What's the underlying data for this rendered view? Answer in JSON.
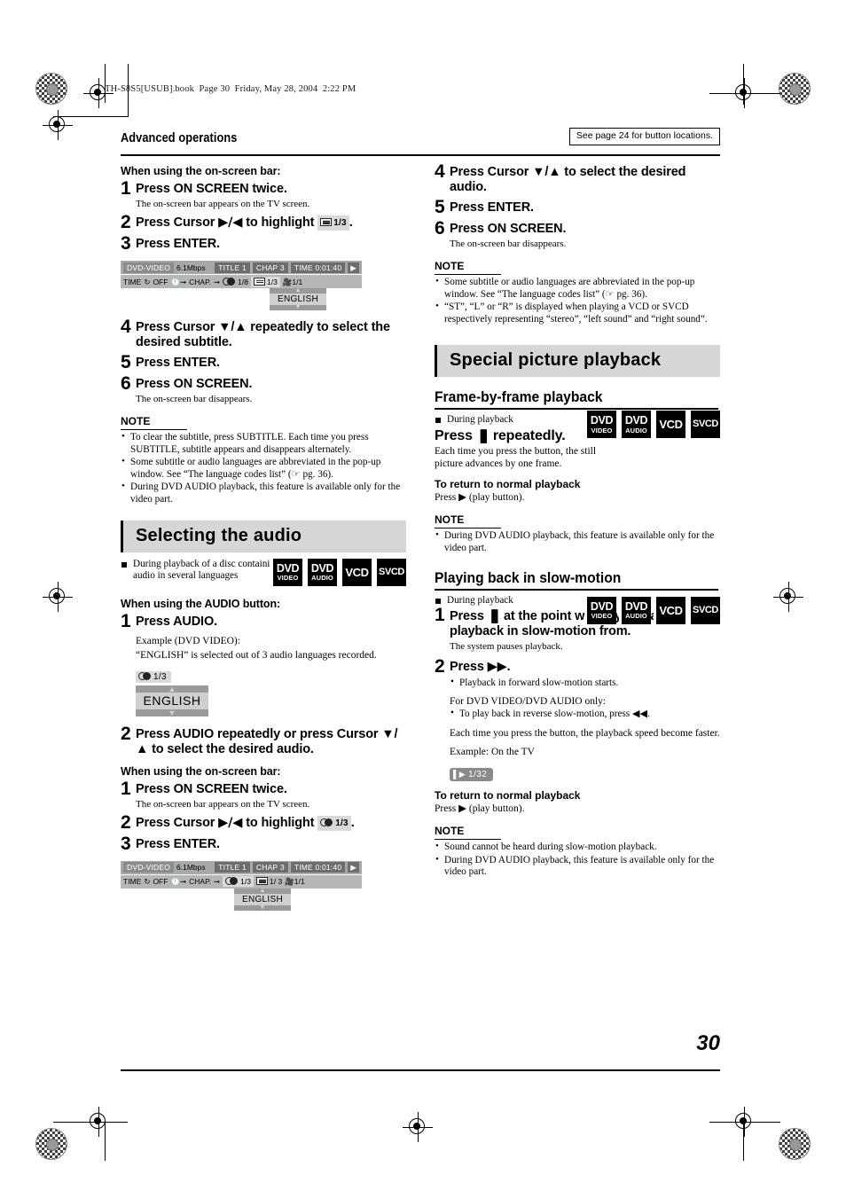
{
  "file_header": "TH-S8S5[USUB].book  Page 30  Friday, May 28, 2004  2:22 PM",
  "running_head": "Advanced operations",
  "see_page_note": "See page 24 for button locations.",
  "page_number": "30",
  "left_column": {
    "subhead_onscreen": "When using the on-screen bar:",
    "steps_subtitle": [
      {
        "num": "1",
        "title": "Press ON SCREEN twice.",
        "desc": "The on-screen bar appears on the TV screen."
      },
      {
        "num": "2",
        "title_pre": "Press Cursor ",
        "title_mid": "▶/◀",
        "title_post": " to highlight",
        "chip": "1/3",
        "title_end": "."
      },
      {
        "num": "3",
        "title": "Press ENTER.",
        "desc": ""
      },
      {
        "num": "4",
        "title": "Press Cursor ▼/▲ repeatedly to select the desired subtitle.",
        "desc": ""
      },
      {
        "num": "5",
        "title": "Press ENTER.",
        "desc": ""
      },
      {
        "num": "6",
        "title": "Press ON SCREEN.",
        "desc": "The on-screen bar disappears."
      }
    ],
    "osb_top": {
      "disc": "DVD-VIDEO",
      "bitrate": "6.1Mbps",
      "title_label": "TITLE",
      "title_value": "1",
      "chap_label": "CHAP",
      "chap_value": "3",
      "time_label": "TIME",
      "time_value": "0:01:40"
    },
    "osb_bottom_1": {
      "time": "TIME",
      "repeat": "OFF",
      "chap_label": "CHAP.",
      "audio_value": "1/8",
      "subtitle_value": "1/3",
      "angle_value": "1/1",
      "popup_lang": "ENGLISH",
      "highlight": "subtitle"
    },
    "osb_bottom_2": {
      "time": "TIME",
      "repeat": "OFF",
      "chap_label": "CHAP.",
      "audio_value": "1/3",
      "subtitle_value": "1/ 3",
      "angle_value": "1/1",
      "popup_lang": "ENGLISH",
      "highlight": "audio"
    },
    "note_subtitle": {
      "label": "NOTE",
      "items": [
        "To clear the subtitle, press SUBTITLE. Each time you press SUBTITLE, subtitle appears and disappears alternately.",
        "Some subtitle or audio languages are abbreviated in the pop-up window. See “The language codes list” (☞ pg. 36).",
        "During DVD AUDIO playback, this feature is available only for the video part."
      ]
    },
    "banner_audio": "Selecting the audio",
    "audio_condition": "During playback of a disc containing audio in several languages",
    "audio_badges": [
      {
        "line1": "DVD",
        "line2": "VIDEO"
      },
      {
        "line1": "DVD",
        "line2": "AUDIO"
      },
      {
        "line1": "VCD",
        "line2": ""
      },
      {
        "line1": "SVCD",
        "line2": ""
      }
    ],
    "subhead_audio_button": "When using the AUDIO button:",
    "audio_step1": {
      "num": "1",
      "title": "Press AUDIO."
    },
    "audio_example_line1": "Example (DVD VIDEO):",
    "audio_example_line2": "“ENGLISH” is selected out of 3 audio languages recorded.",
    "audio_popup": {
      "tag": "1/3",
      "lang": "ENGLISH"
    },
    "audio_step2": {
      "num": "2",
      "title": "Press AUDIO repeatedly or press Cursor ▼/▲ to select the desired audio."
    },
    "subhead_onscreen2": "When using the on-screen bar:",
    "steps_audio_osb": [
      {
        "num": "1",
        "title": "Press ON SCREEN twice.",
        "desc": "The on-screen bar appears on the TV screen."
      },
      {
        "num": "2",
        "title_pre": "Press Cursor ",
        "title_mid": "▶/◀",
        "title_post": " to highlight",
        "chip": "1/3",
        "title_end": "."
      },
      {
        "num": "3",
        "title": "Press ENTER.",
        "desc": ""
      }
    ]
  },
  "right_column": {
    "steps_top": [
      {
        "num": "4",
        "title": "Press Cursor ▼/▲ to select the desired audio.",
        "desc": ""
      },
      {
        "num": "5",
        "title": "Press ENTER.",
        "desc": ""
      },
      {
        "num": "6",
        "title": "Press ON SCREEN.",
        "desc": "The on-screen bar disappears."
      }
    ],
    "note_audio": {
      "label": "NOTE",
      "items": [
        "Some subtitle or audio languages are abbreviated in the pop-up window. See “The language codes list” (☞ pg. 36).",
        "“ST”, “L” or “R” is displayed when playing a VCD or SVCD respectively representing “stereo”, “left sound” and “right sound”."
      ]
    },
    "banner_special": "Special picture playback",
    "frame_section": {
      "heading": "Frame-by-frame playback",
      "condition": "During playback",
      "instruction_pre": "Press ",
      "instruction_icon": "▐▌",
      "instruction_post": " repeatedly.",
      "desc": "Each time you press the button, the still picture advances by one frame.",
      "return_head": "To return to normal playback",
      "return_text_pre": "Press ",
      "return_text_icon": "▶",
      "return_text_post": " (play button).",
      "badges": [
        {
          "line1": "DVD",
          "line2": "VIDEO"
        },
        {
          "line1": "DVD",
          "line2": "AUDIO"
        },
        {
          "line1": "VCD",
          "line2": ""
        },
        {
          "line1": "SVCD",
          "line2": ""
        }
      ],
      "note": {
        "label": "NOTE",
        "items": [
          "During DVD AUDIO playback, this feature is available only for the video part."
        ]
      }
    },
    "slow_section": {
      "heading": "Playing back in slow-motion",
      "condition": "During playback",
      "step1": {
        "num": "1",
        "title_pre": "Press ",
        "title_icon": "▐▌",
        "title_post": " at the point where you want to start playback in slow-motion from.",
        "desc": "The system pauses playback."
      },
      "step2": {
        "num": "2",
        "title_pre": "Press ",
        "title_icon": "▶▶",
        "title_post": ".",
        "bullets": [
          "Playback in forward slow-motion starts."
        ],
        "sub_note_head": "For DVD VIDEO/DVD AUDIO only:",
        "sub_note_bullets": [
          "To play back in reverse slow-motion, press ◀◀."
        ],
        "para": "Each time you press the button, the playback speed become faster.",
        "example_label": "Example: On the TV",
        "speed_chip": "1/32"
      },
      "return_head": "To return to normal playback",
      "return_text_pre": "Press ",
      "return_text_icon": "▶",
      "return_text_post": " (play button).",
      "badges": [
        {
          "line1": "DVD",
          "line2": "VIDEO"
        },
        {
          "line1": "DVD",
          "line2": "AUDIO"
        },
        {
          "line1": "VCD",
          "line2": ""
        },
        {
          "line1": "SVCD",
          "line2": ""
        }
      ],
      "note": {
        "label": "NOTE",
        "items": [
          "Sound cannot be heard during slow-motion playback.",
          "During DVD AUDIO playback, this feature is available only for the video part."
        ]
      }
    }
  }
}
